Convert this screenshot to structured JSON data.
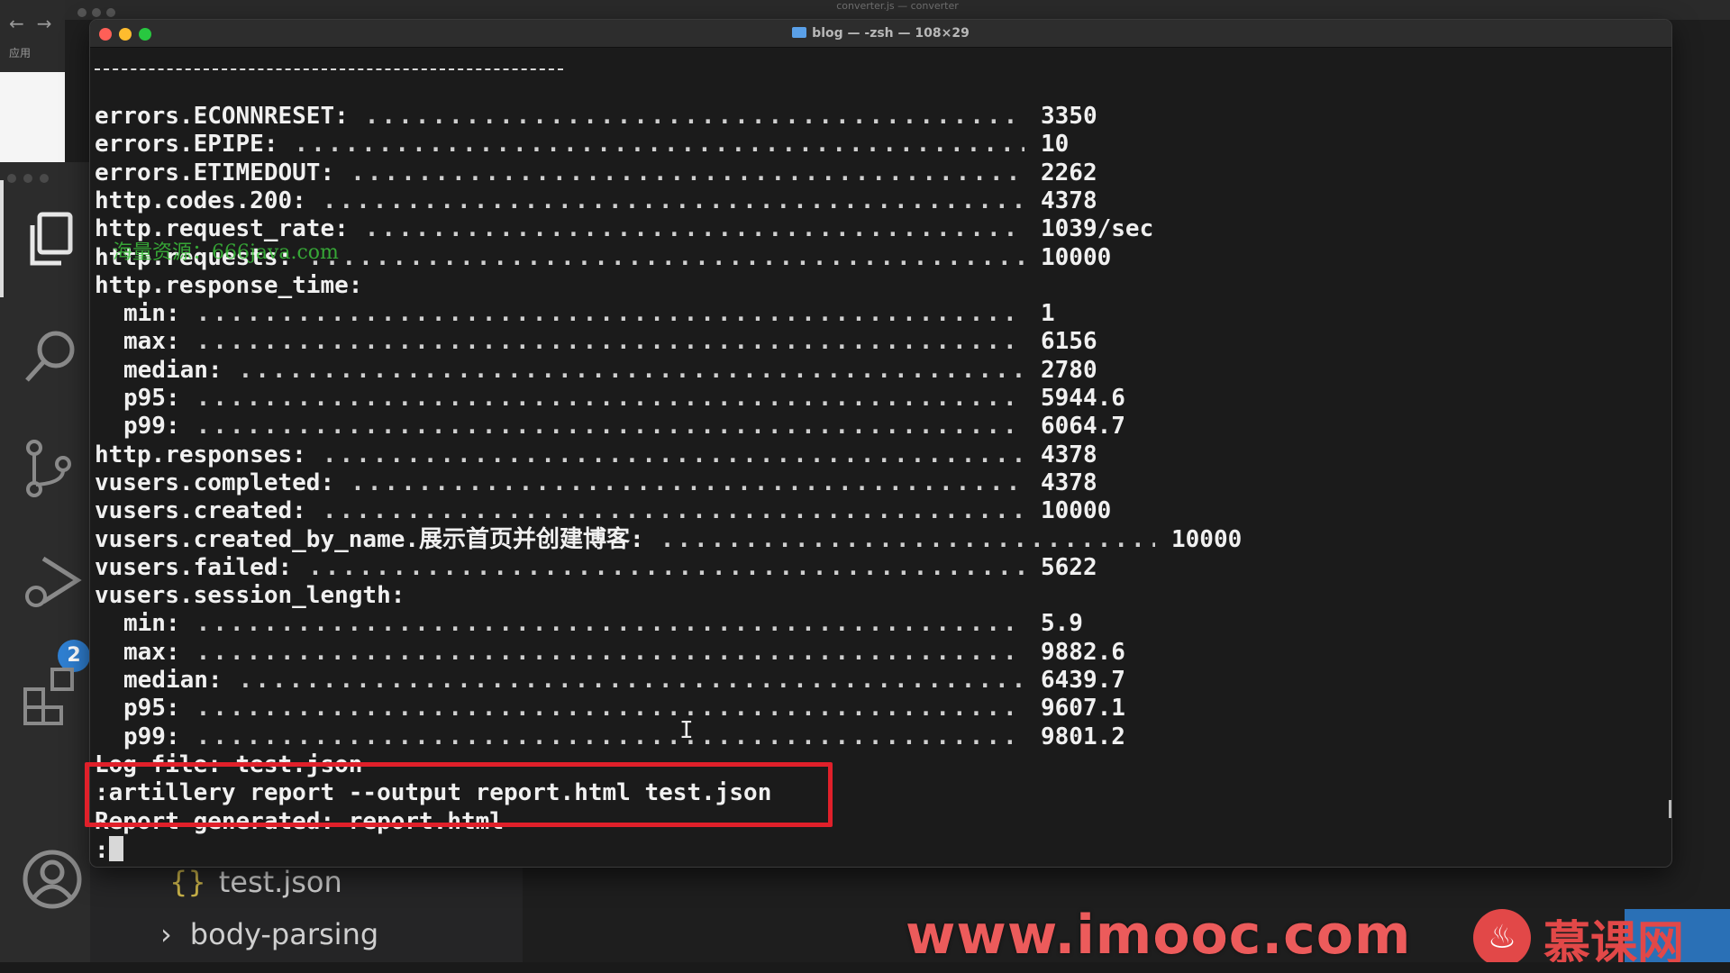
{
  "background": {
    "browser_apps_label": "应用",
    "editor_title": "converter.js — converter"
  },
  "terminal": {
    "window_title": "blog — -zsh — 108×29",
    "lines": [
      {
        "key": "errors.ECONNRESET:",
        "value": "3350",
        "indent": 0
      },
      {
        "key": "errors.EPIPE:",
        "value": "10",
        "indent": 0
      },
      {
        "key": "errors.ETIMEDOUT:",
        "value": "2262",
        "indent": 0
      },
      {
        "key": "http.codes.200:",
        "value": "4378",
        "indent": 0
      },
      {
        "key": "http.request_rate:",
        "value": "1039/sec",
        "indent": 0
      },
      {
        "key": "http.requests:",
        "value": "10000",
        "indent": 0
      },
      {
        "key": "http.response_time:",
        "value": "",
        "indent": 0
      },
      {
        "key": "min:",
        "value": "1",
        "indent": 1
      },
      {
        "key": "max:",
        "value": "6156",
        "indent": 1
      },
      {
        "key": "median:",
        "value": "2780",
        "indent": 1
      },
      {
        "key": "p95:",
        "value": "5944.6",
        "indent": 1
      },
      {
        "key": "p99:",
        "value": "6064.7",
        "indent": 1
      },
      {
        "key": "http.responses:",
        "value": "4378",
        "indent": 0
      },
      {
        "key": "vusers.completed:",
        "value": "4378",
        "indent": 0
      },
      {
        "key": "vusers.created:",
        "value": "10000",
        "indent": 0
      },
      {
        "key": "vusers.created_by_name.展示首页并创建博客:",
        "value": "10000",
        "indent": 0,
        "wide": true
      },
      {
        "key": "vusers.failed:",
        "value": "5622",
        "indent": 0
      },
      {
        "key": "vusers.session_length:",
        "value": "",
        "indent": 0
      },
      {
        "key": "min:",
        "value": "5.9",
        "indent": 1
      },
      {
        "key": "max:",
        "value": "9882.6",
        "indent": 1
      },
      {
        "key": "median:",
        "value": "6439.7",
        "indent": 1
      },
      {
        "key": "p95:",
        "value": "9607.1",
        "indent": 1
      },
      {
        "key": "p99:",
        "value": "9801.2",
        "indent": 1
      }
    ],
    "log_file_line": "Log file: test.json",
    "command_line": ":artillery report --output report.html test.json",
    "report_line": "Report generated: report.html",
    "prompt": ":"
  },
  "explorer": {
    "file_item": "test.json",
    "folder_item": "body-parsing"
  },
  "activity_bar": {
    "source_control_badge": "2"
  },
  "watermarks": {
    "site_url": "www.imooc.com",
    "brand": "慕课网",
    "overlay_text": "海量资源：666java.com"
  }
}
